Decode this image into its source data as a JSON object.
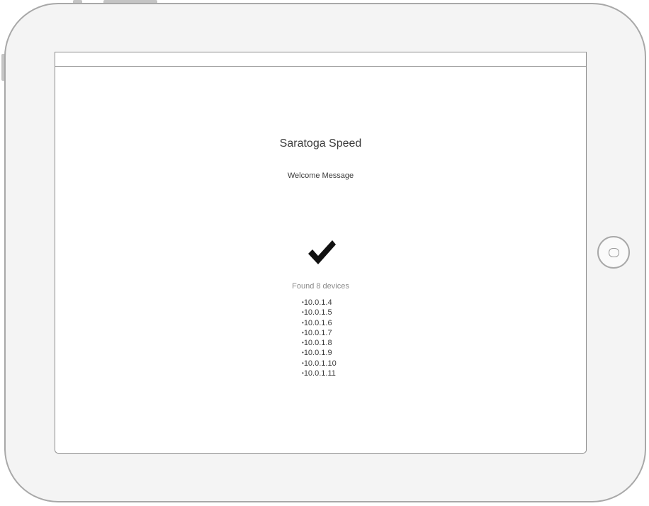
{
  "app": {
    "title": "Saratoga Speed",
    "welcome_message": "Welcome Message"
  },
  "scan": {
    "status_icon": "checkmark-icon",
    "found_text": "Found 8 devices",
    "devices": [
      "10.0.1.4",
      "10.0.1.5",
      "10.0.1.6",
      "10.0.1.7",
      "10.0.1.8",
      "10.0.1.9",
      "10.0.1.10",
      "10.0.1.11"
    ]
  },
  "device_frame": {
    "type": "tablet-landscape",
    "home_button_icon": "home-button-icon"
  }
}
